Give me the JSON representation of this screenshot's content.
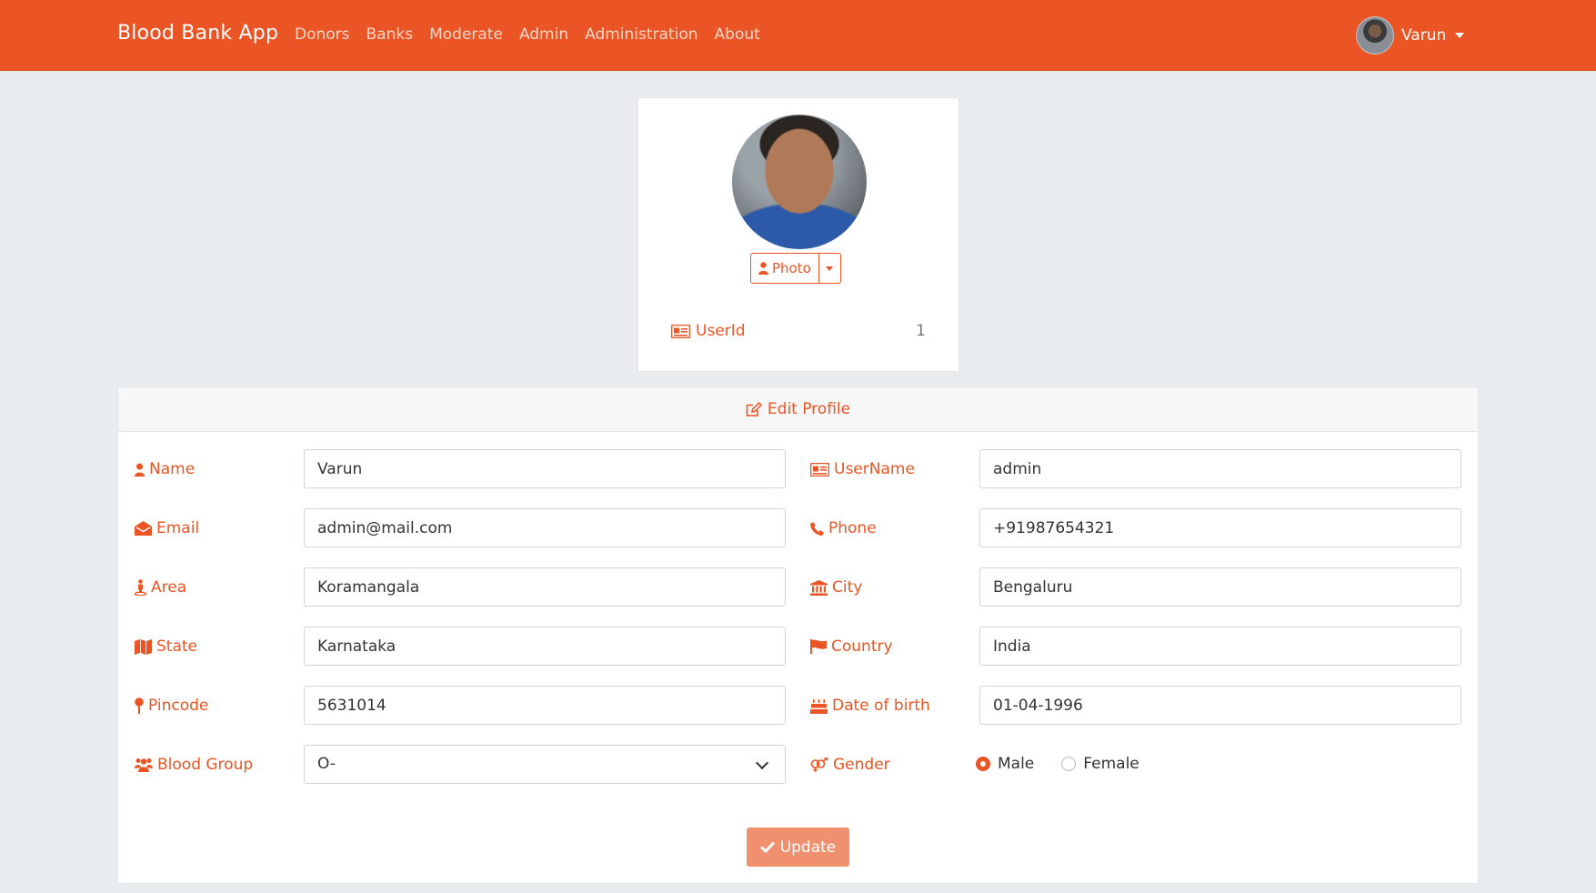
{
  "navbar": {
    "brand": "Blood Bank App",
    "links": [
      "Donors",
      "Banks",
      "Moderate",
      "Admin",
      "Administration",
      "About"
    ],
    "user_name": "Varun"
  },
  "profile": {
    "photo_button": "Photo",
    "userid_label": "UserId",
    "userid_value": "1"
  },
  "edit_profile": {
    "header": "Edit Profile",
    "fields": {
      "name": {
        "label": "Name",
        "value": "Varun"
      },
      "username": {
        "label": "UserName",
        "value": "admin"
      },
      "email": {
        "label": "Email",
        "value": "admin@mail.com"
      },
      "phone": {
        "label": "Phone",
        "value": "+91987654321"
      },
      "area": {
        "label": "Area",
        "value": "Koramangala"
      },
      "city": {
        "label": "City",
        "value": "Bengaluru"
      },
      "state": {
        "label": "State",
        "value": "Karnataka"
      },
      "country": {
        "label": "Country",
        "value": "India"
      },
      "pincode": {
        "label": "Pincode",
        "value": "5631014"
      },
      "dob": {
        "label": "Date of birth",
        "value": "01-04-1996"
      },
      "blood_group": {
        "label": "Blood Group",
        "value": "O-"
      },
      "gender": {
        "label": "Gender",
        "options": [
          "Male",
          "Female"
        ],
        "selected": "Male"
      }
    },
    "update_button": "Update"
  },
  "colors": {
    "accent": "#eb5424",
    "update_button": "#f1906f",
    "background": "#e9ecef"
  }
}
